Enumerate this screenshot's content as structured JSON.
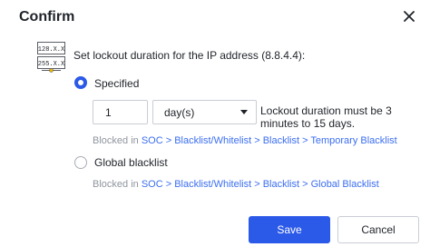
{
  "dialog": {
    "title": "Confirm",
    "close_icon": "close-icon"
  },
  "prompt": {
    "icon": "ip-address-icon",
    "text": "Set lockout duration for the IP address (8.8.4.4):"
  },
  "options": {
    "specified": {
      "label": "Specified",
      "selected": true,
      "duration_value": "1",
      "unit": "day(s)",
      "hint": "Lockout duration must be 3 minutes to 15 days.",
      "path_prefix": "Blocked in",
      "path_link": "SOC > Blacklist/Whitelist > Blacklist > Temporary Blacklist"
    },
    "global": {
      "label": "Global blacklist",
      "selected": false,
      "path_prefix": "Blocked in",
      "path_link": "SOC > Blacklist/Whitelist > Blacklist > Global Blacklist"
    }
  },
  "footer": {
    "save_label": "Save",
    "cancel_label": "Cancel"
  },
  "colors": {
    "primary": "#2b59e8",
    "link": "#3b6ef0",
    "muted": "#8f959e"
  }
}
